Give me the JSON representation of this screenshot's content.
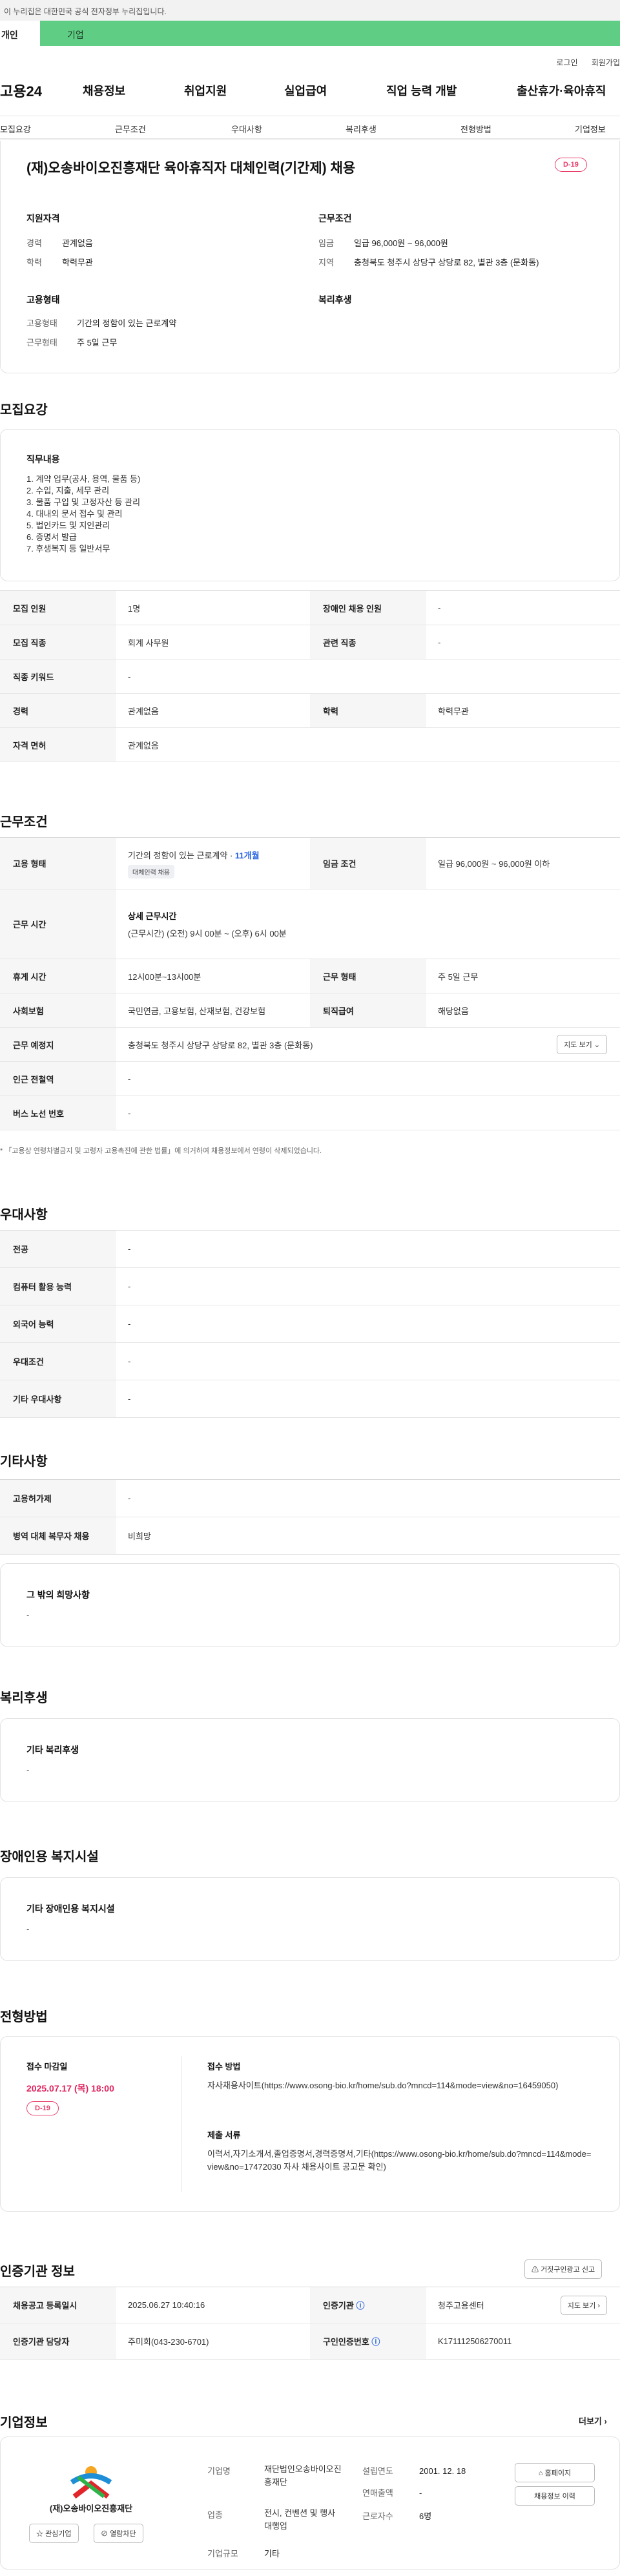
{
  "gov_banner": "이 누리집은 대한민국 공식 전자정부 누리집입니다.",
  "type_tabs": {
    "person": "개인",
    "business": "기업"
  },
  "util_links": [
    "로그인",
    "회원가입"
  ],
  "logo": "고용24",
  "main_nav": [
    "채용정보",
    "취업지원",
    "실업급여",
    "직업 능력 개발",
    "출산휴가·육아휴직"
  ],
  "sub_nav": [
    "모집요강",
    "근무조건",
    "우대사항",
    "복리후생",
    "전형방법",
    "기업정보"
  ],
  "job": {
    "title": "(재)오송바이오진흥재단 육아휴직자 대체인력(기간제) 채용",
    "dday": "D-19",
    "qual_title": "지원자격",
    "qual": [
      {
        "k": "경력",
        "v": "관계없음"
      },
      {
        "k": "학력",
        "v": "학력무관"
      }
    ],
    "cond_title": "근무조건",
    "cond": [
      {
        "k": "임금",
        "v": "일급 96,000원 ~ 96,000원"
      },
      {
        "k": "지역",
        "v": "충청북도 청주시 상당구 상당로 82, 별관 3층 (문화동)"
      }
    ],
    "emp_title": "고용형태",
    "emp": [
      {
        "k": "고용형태",
        "v": "기간의 정함이 있는 근로계약"
      },
      {
        "k": "근무형태",
        "v": "주 5일 근무"
      }
    ],
    "welfare_title": "복리후생"
  },
  "recruit": {
    "title": "모집요강",
    "duty_title": "직무내용",
    "duties": [
      "1. 계약 업무(공사, 용역, 물품 등)",
      "2. 수입, 지출, 세무 관리",
      "3. 물품 구입 및 고정자산 등 관리",
      "4. 대내외 문서 접수 및 관리",
      "5. 법인카드 및 지인관리",
      "6. 증명서 발급",
      "7. 후생복지 등 일반서무"
    ],
    "rows": [
      {
        "k1": "모집 인원",
        "v1": "1명",
        "k2": "장애인 채용 인원",
        "v2": "-"
      },
      {
        "k1": "모집 직종",
        "v1": "회계 사무원",
        "k2": "관련 직종",
        "v2": "-"
      },
      {
        "k1": "직종 키워드",
        "v1": "-"
      },
      {
        "k1": "경력",
        "v1": "관계없음",
        "k2": "학력",
        "v2": "학력무관"
      },
      {
        "k1": "자격 면허",
        "v1": "관계없음"
      }
    ]
  },
  "work": {
    "title": "근무조건",
    "emp_label": "고용 형태",
    "emp_value": "기간의 정함이 있는 근로계약 · ",
    "emp_months": "11개월",
    "emp_tag": "대체인력 채용",
    "wage_label": "임금 조건",
    "wage_value": "일급 96,000원 ~ 96,000원 이하",
    "time_label": "근무 시간",
    "time_title": "상세 근무시간",
    "time_value": "(근무시간) (오전) 9시 00분 ~ (오후) 6시 00분",
    "break_label": "휴게 시간",
    "break_value": "12시00분~13시00분",
    "shift_label": "근무 형태",
    "shift_value": "주 5일 근무",
    "insurance_label": "사회보험",
    "insurance_value": "국민연금, 고용보험, 산재보험, 건강보험",
    "retire_label": "퇴직급여",
    "retire_value": "해당없음",
    "place_label": "근무 예정지",
    "place_value": "충청북도 청주시 상당구 상당로 82, 별관 3층 (문화동)",
    "map_btn": "지도 보기",
    "subway_label": "인근 전철역",
    "subway_value": "-",
    "bus_label": "버스 노선 번호",
    "bus_value": "-",
    "note": "* 「고용상 연령차별금지 및 고령자 고용촉진에 관한 법률」에 의거하여 채용정보에서 연령이 삭제되었습니다."
  },
  "pref": {
    "title": "우대사항",
    "rows": [
      {
        "k": "전공",
        "v": "-"
      },
      {
        "k": "컴퓨터 활용 능력",
        "v": "-"
      },
      {
        "k": "외국어 능력",
        "v": "-"
      },
      {
        "k": "우대조건",
        "v": "-"
      },
      {
        "k": "기타 우대사항",
        "v": "-"
      }
    ]
  },
  "etc": {
    "title": "기타사항",
    "rows": [
      {
        "k": "고용허가제",
        "v": "-"
      },
      {
        "k": "병역 대체 복무자 채용",
        "v": "비희망"
      }
    ],
    "wish_title": "그 밖의 희망사항",
    "wish_value": "-"
  },
  "welfare": {
    "title": "복리후생",
    "sub": "기타 복리후생",
    "value": "-"
  },
  "disabled": {
    "title": "장애인용 복지시설",
    "sub": "기타 장애인용 복지시설",
    "value": "-"
  },
  "screening": {
    "title": "전형방법",
    "deadline_title": "접수 마감일",
    "deadline": "2025.07.17 (목) 18:00",
    "dday": "D-19",
    "method_title": "접수 방법",
    "method_value": "자사채용사이트(https://www.osong-bio.kr/home/sub.do?mncd=114&mode=view&no=16459050)",
    "docs_title": "제출 서류",
    "docs_value": "이력서,자기소개서,졸업증명서,경력증명서,기타(https://www.osong-bio.kr/home/sub.do?mncd=114&mode=view&no=17472030 자사 채용사이트 공고문 확인)"
  },
  "cert": {
    "title": "인증기관 정보",
    "report_btn": "거짓구인광고 신고",
    "rows": [
      {
        "k1": "채용공고 등록일시",
        "v1": "2025.06.27 10:40:16",
        "k2": "인증기관",
        "v2": "청주고용센터"
      },
      {
        "k1": "인증기관 담당자",
        "v1": "주미희(043-230-6701)",
        "k2": "구인인증번호",
        "v2": "K171112506270011"
      }
    ],
    "map_btn": "지도 보기"
  },
  "company": {
    "title": "기업정보",
    "more": "더보기",
    "name_ko": "(재)오송바이오진흥재단",
    "interest_btn": "관심기업",
    "block_btn": "열람차단",
    "fields": [
      {
        "k": "기업명",
        "v": "재단법인오송바이오진흥재단"
      },
      {
        "k": "업종",
        "v": "전시, 컨벤션 및 행사 대행업"
      },
      {
        "k": "기업규모",
        "v": "기타"
      }
    ],
    "fields2": [
      {
        "k": "설립연도",
        "v": "2001. 12. 18"
      },
      {
        "k": "연매출액",
        "v": "-"
      },
      {
        "k": "근로자수",
        "v": "6명"
      }
    ],
    "homepage_btn": "홈페이지",
    "jobs_btn": "채용정보 이력"
  }
}
